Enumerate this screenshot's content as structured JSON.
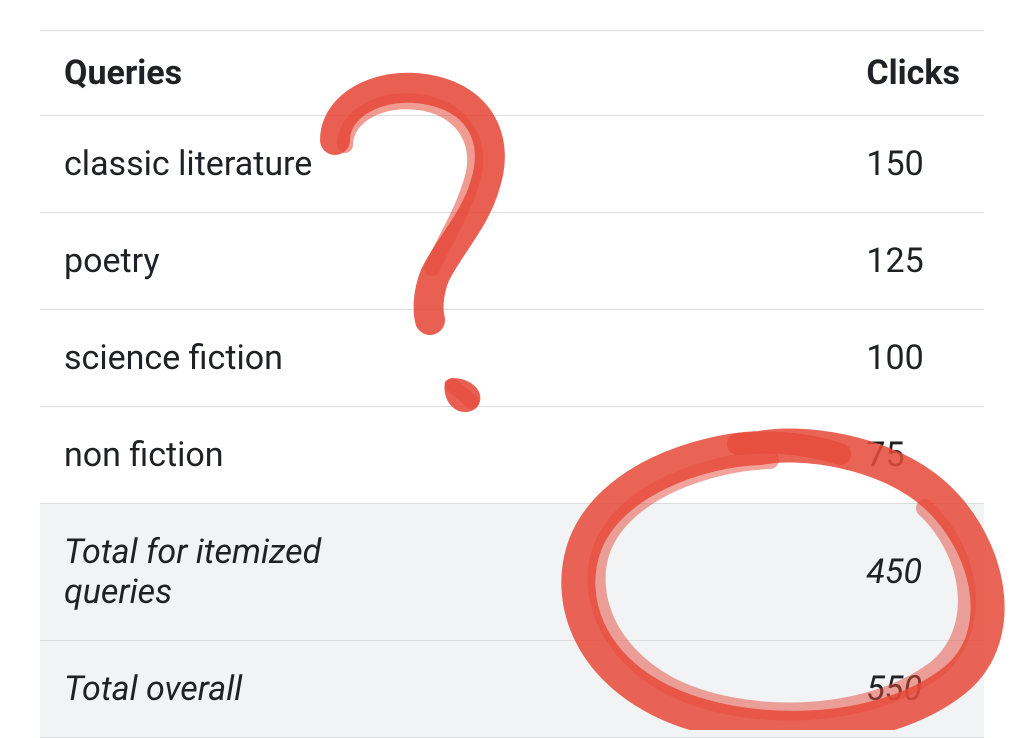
{
  "table": {
    "headers": {
      "queries": "Queries",
      "clicks": "Clicks"
    },
    "rows": [
      {
        "query": "classic literature",
        "clicks": "150"
      },
      {
        "query": "poetry",
        "clicks": "125"
      },
      {
        "query": "science fiction",
        "clicks": "100"
      },
      {
        "query": "non fiction",
        "clicks": "75"
      }
    ],
    "totals": [
      {
        "label": "Total for itemized queries",
        "clicks": "450"
      },
      {
        "label": "Total overall",
        "clicks": "550"
      }
    ]
  },
  "annotations": {
    "color": "#e64a3a"
  }
}
